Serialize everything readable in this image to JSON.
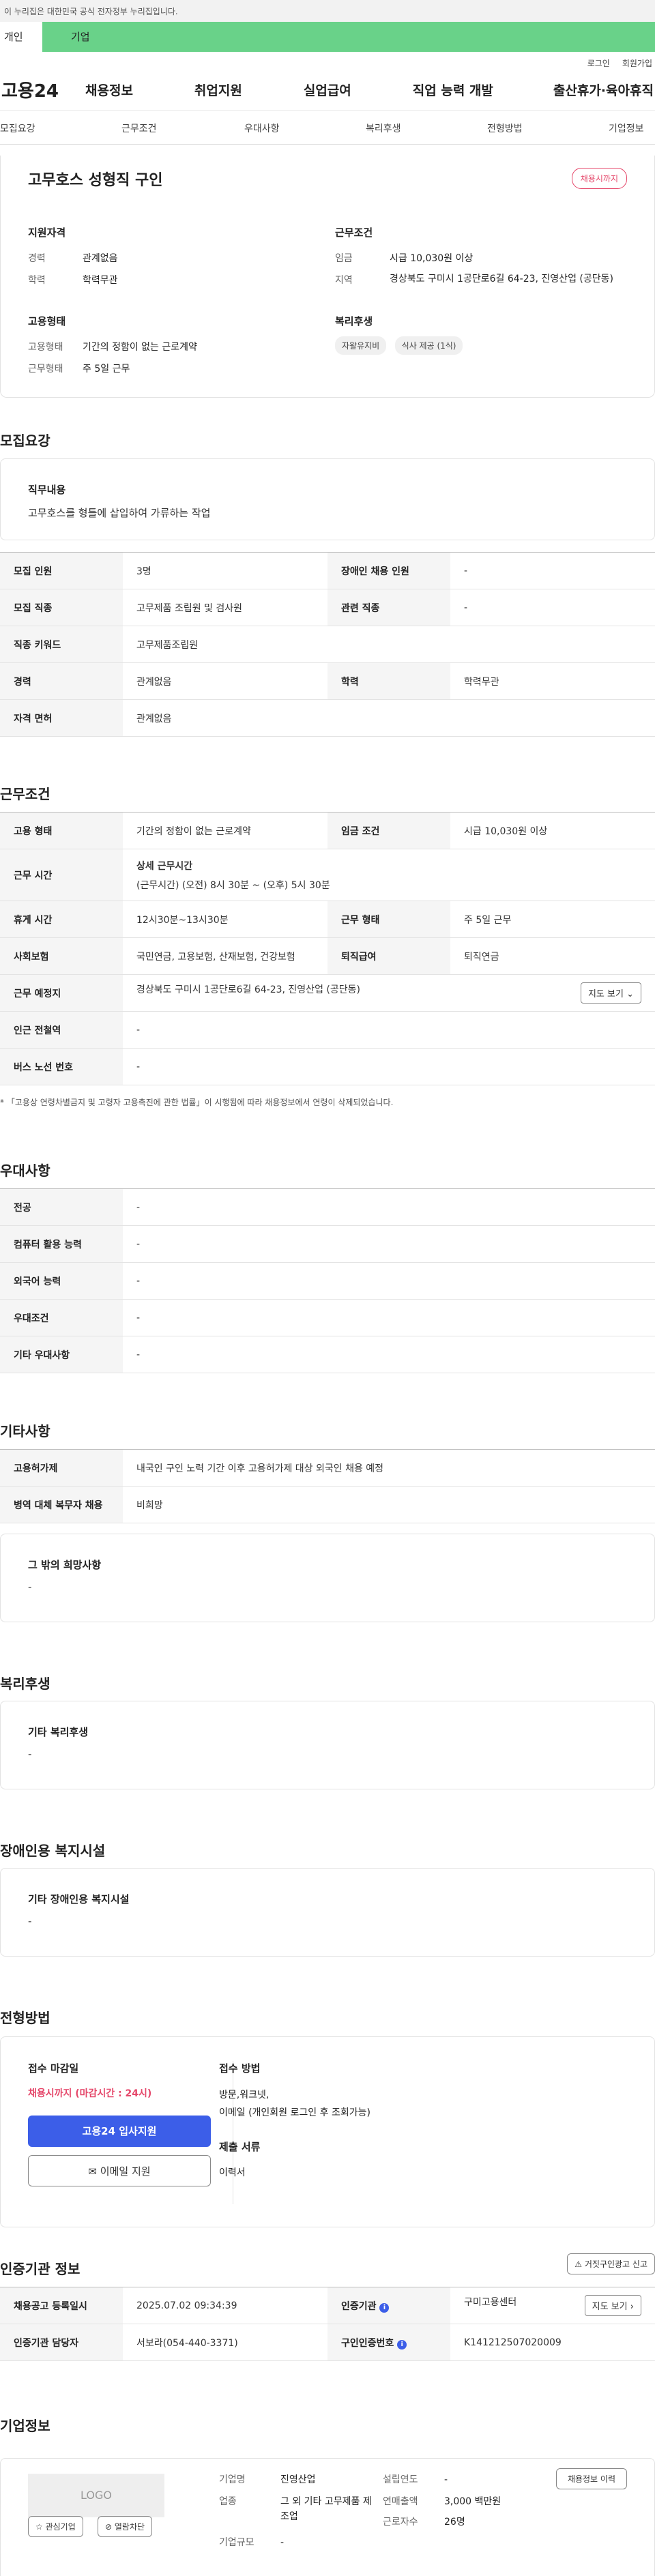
{
  "topbar": {
    "gov_notice": "이 누리집은 대한민국 공식 전자정부 누리집입니다.",
    "tab_personal": "개인",
    "tab_business": "기업"
  },
  "util": {
    "login": "로그인",
    "signup": "회원가입"
  },
  "gnb": {
    "logo": "고용24",
    "items": [
      "채용정보",
      "취업지원",
      "실업급여",
      "직업 능력 개발",
      "출산휴가·육아휴직"
    ]
  },
  "subnav": [
    "모집요강",
    "근무조건",
    "우대사항",
    "복리후생",
    "전형방법",
    "기업정보"
  ],
  "summary": {
    "title": "고무호스 성형직 구인",
    "badge": "채용시까지",
    "qual_heading": "지원자격",
    "career_label": "경력",
    "career": "관계없음",
    "edu_label": "학력",
    "edu": "학력무관",
    "cond_heading": "근무조건",
    "wage_label": "임금",
    "wage": "시급 10,030원 이상",
    "region_label": "지역",
    "region": "경상북도 구미시 1공단로6길 64-23, 진영산업 (공단동)",
    "emptype_heading": "고용형태",
    "emptype_label": "고용형태",
    "emptype": "기간의 정함이 없는 근로계약",
    "worktype_label": "근무형태",
    "worktype": "주 5일 근무",
    "welfare_heading": "복리후생",
    "welfare_chips": [
      "자왈유지비",
      "식사 제공 (1식)"
    ]
  },
  "recruit": {
    "title": "모집요강",
    "duty_heading": "직무내용",
    "duty": "고무호스를 형틀에 삽입하여 가류하는 작업",
    "rows": [
      {
        "k1": "모집 인원",
        "v1": "3명",
        "k2": "장애인 채용 인원",
        "v2": "-"
      },
      {
        "k1": "모집 직종",
        "v1": "고무제품 조립원 및 검사원",
        "k2": "관련 직종",
        "v2": "-"
      },
      {
        "k1": "직종 키워드",
        "v1": "고무제품조립원"
      },
      {
        "k1": "경력",
        "v1": "관계없음",
        "k2": "학력",
        "v2": "학력무관"
      },
      {
        "k1": "자격 면허",
        "v1": "관계없음"
      }
    ]
  },
  "work": {
    "title": "근무조건",
    "emp_k": "고용 형태",
    "emp_v": "기간의 정함이 없는 근로계약",
    "wage_k": "임금 조건",
    "wage_v": "시급 10,030원 이상",
    "time_k": "근무 시간",
    "time_v1": "상세 근무시간",
    "time_v2": "(근무시간) (오전) 8시 30분 ~ (오후) 5시 30분",
    "rest_k": "휴게 시간",
    "rest_v": "12시30분~13시30분",
    "form_k": "근무 형태",
    "form_v": "주 5일 근무",
    "ins_k": "사회보험",
    "ins_v": "국민연금, 고용보험, 산재보험, 건강보험",
    "sev_k": "퇴직급여",
    "sev_v": "퇴직연금",
    "place_k": "근무 예정지",
    "place_v": "경상북도 구미시 1공단로6길 64-23, 진영산업 (공단동)",
    "map_btn": "지도 보기",
    "station_k": "인근 전철역",
    "station_v": "-",
    "bus_k": "버스 노선 번호",
    "bus_v": "-",
    "note": "* 「고용상 연령차별금지 및 고령자 고용촉진에 관한 법률」이 시행됨에 따라 채용정보에서 연령이 삭제되었습니다."
  },
  "pref": {
    "title": "우대사항",
    "rows": [
      {
        "k": "전공",
        "v": "-"
      },
      {
        "k": "컴퓨터 활용 능력",
        "v": "-"
      },
      {
        "k": "외국어 능력",
        "v": "-"
      },
      {
        "k": "우대조건",
        "v": "-"
      },
      {
        "k": "기타 우대사항",
        "v": "-"
      }
    ]
  },
  "etc": {
    "title": "기타사항",
    "rows": [
      {
        "k": "고용허가제",
        "v": "내국인 구인 노력 기간 이후 고용허가제 대상 외국인 채용 예정"
      },
      {
        "k": "병역 대체 복무자 채용",
        "v": "비희망"
      }
    ],
    "other_heading": "그 밖의 희망사항",
    "other_value": "-"
  },
  "welfare": {
    "title": "복리후생",
    "heading": "기타 복리후생",
    "value": "-"
  },
  "disability": {
    "title": "장애인용 복지시설",
    "heading": "기타 장애인용 복지시설",
    "value": "-"
  },
  "apply": {
    "title": "전형방법",
    "deadline_heading": "접수 마감일",
    "deadline": "채용시까지 (마감시간 : 24시)",
    "apply_btn": "고용24 입사지원",
    "email_btn": "이메일 지원",
    "method_heading": "접수 방법",
    "method1": "방문,워크넷,",
    "method2": "이메일 (개인회원 로그인 후 조회가능)",
    "docs_heading": "제출 서류",
    "docs": "이력서"
  },
  "agency": {
    "title": "인증기관 정보",
    "report_btn": "거짓구인광고 신고",
    "reg_k": "채용공고 등록일시",
    "reg_v": "2025.07.02 09:34:39",
    "org_k": "인증기관",
    "org_v": "구미고용센터",
    "map_btn": "지도 보기",
    "mgr_k": "인증기관 담당자",
    "mgr_v": "서보라(054-440-3371)",
    "num_k": "구인인증번호",
    "num_v": "K141212507020009"
  },
  "company": {
    "title": "기업정보",
    "logo": "LOGO",
    "fav_btn": "관심기업",
    "block_btn": "열람차단",
    "history_btn": "채용정보 이력",
    "name_k": "기업명",
    "name_v": "진영산업",
    "ind_k": "업종",
    "ind_v": "그 외 기타 고무제품 제조업",
    "size_k": "기업규모",
    "size_v": "-",
    "year_k": "설립연도",
    "year_v": "-",
    "sales_k": "연매출액",
    "sales_v": "3,000 백만원",
    "emp_k": "근로자수",
    "emp_v": "26명"
  },
  "colors": {
    "accent_green": "#69d289",
    "primary_blue": "#3c5ee8",
    "badge_red": "#e5476a"
  }
}
